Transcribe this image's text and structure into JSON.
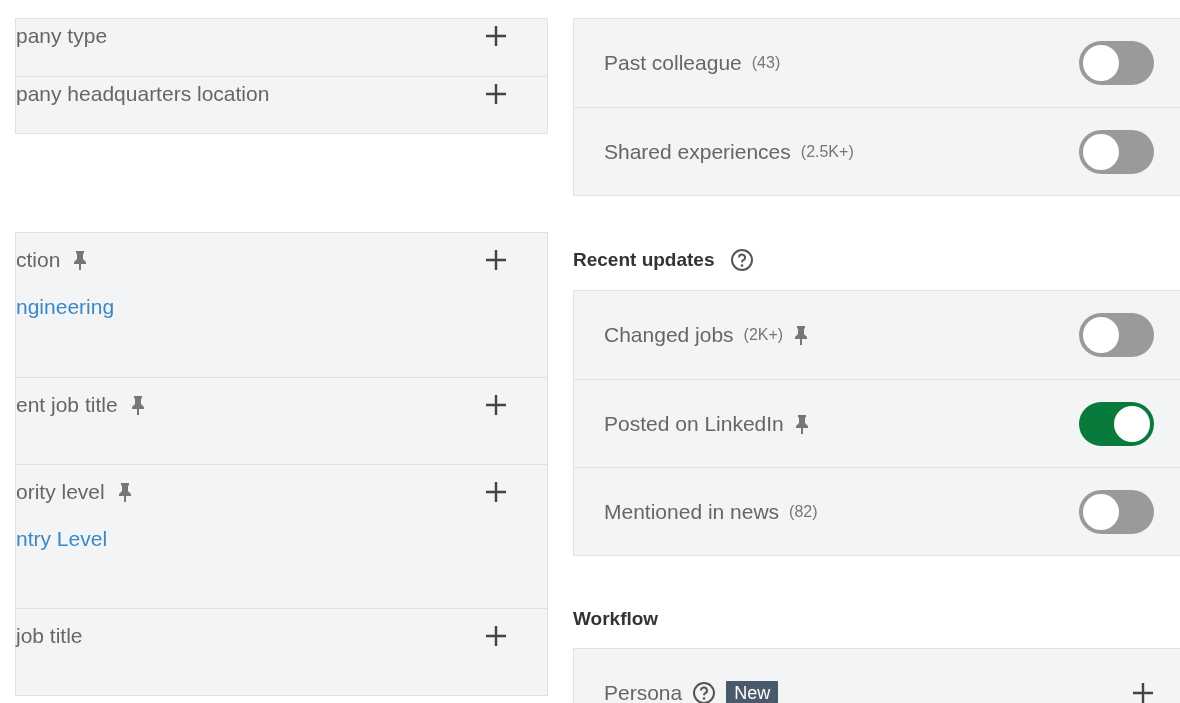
{
  "left_groups": [
    {
      "rows": [
        {
          "label": "pany type",
          "pinned": false
        },
        {
          "label": "pany headquarters location",
          "pinned": false
        }
      ]
    },
    {
      "rows": [
        {
          "label": "ction",
          "pinned": true,
          "value": "ngineering"
        },
        {
          "label": "ent job title",
          "pinned": true
        },
        {
          "label": "ority level",
          "pinned": true,
          "value": "ntry Level"
        },
        {
          "label": "job title",
          "pinned": false
        }
      ]
    }
  ],
  "right_sections": [
    {
      "rows": [
        {
          "kind": "toggle",
          "label": "Past colleague",
          "count": "(43)",
          "pinned": false,
          "on": false
        },
        {
          "kind": "toggle",
          "label": "Shared experiences",
          "count": "(2.5K+)",
          "pinned": false,
          "on": false
        }
      ]
    },
    {
      "heading": "Recent updates",
      "help": true,
      "rows": [
        {
          "kind": "toggle",
          "label": "Changed jobs",
          "count": "(2K+)",
          "pinned": true,
          "on": false
        },
        {
          "kind": "toggle",
          "label": "Posted on LinkedIn",
          "pinned": true,
          "on": true
        },
        {
          "kind": "toggle",
          "label": "Mentioned in news",
          "count": "(82)",
          "pinned": false,
          "on": false
        }
      ]
    },
    {
      "heading": "Workflow",
      "help": false,
      "rows": [
        {
          "kind": "add",
          "label": "Persona",
          "help": true,
          "badge": "New"
        }
      ]
    }
  ]
}
